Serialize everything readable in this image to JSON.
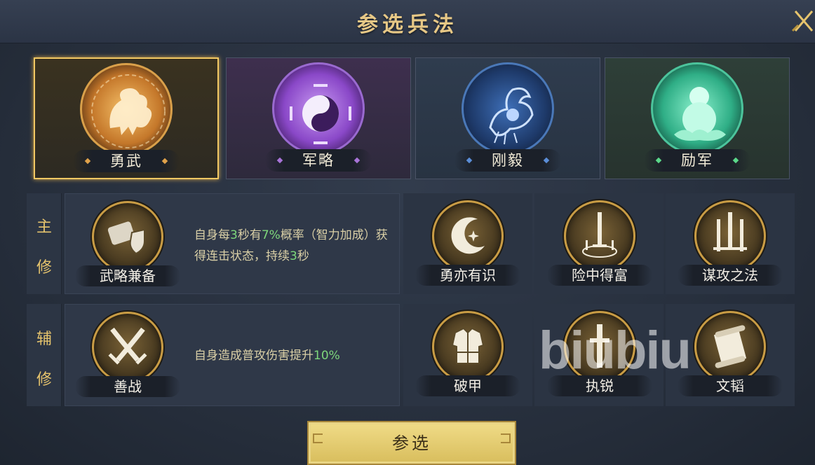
{
  "title": "参选兵法",
  "categories": [
    {
      "label": "勇武",
      "selected": true,
      "icon": "qilin-emblem-icon",
      "color": "#e9a84a"
    },
    {
      "label": "军略",
      "selected": false,
      "icon": "yin-yang-emblem-icon",
      "color": "#a874d8"
    },
    {
      "label": "刚毅",
      "selected": false,
      "icon": "phoenix-emblem-icon",
      "color": "#5b8ed8"
    },
    {
      "label": "励军",
      "selected": false,
      "icon": "gourd-emblem-icon",
      "color": "#5bd8a4"
    }
  ],
  "main": {
    "side_label_1": "主",
    "side_label_2": "修",
    "selected_skill": "武略兼备",
    "desc_parts": [
      "自身每",
      "3",
      "秒有",
      "7%",
      "概率（智力加成）获得连击状态，持续",
      "3",
      "秒"
    ],
    "alternatives": [
      "勇亦有识",
      "险中得富",
      "谋攻之法"
    ]
  },
  "aux": {
    "side_label_1": "辅",
    "side_label_2": "修",
    "selected_skill": "善战",
    "desc_parts": [
      "自身造成普攻伤害提升",
      "10%"
    ],
    "alternatives": [
      "破甲",
      "执锐",
      "文韬"
    ]
  },
  "confirm_label": "参选",
  "watermark": "biubiu",
  "colors": {
    "accent": "#e6c46d",
    "highlight": "#7ed77b",
    "button": "#e4cc72"
  }
}
